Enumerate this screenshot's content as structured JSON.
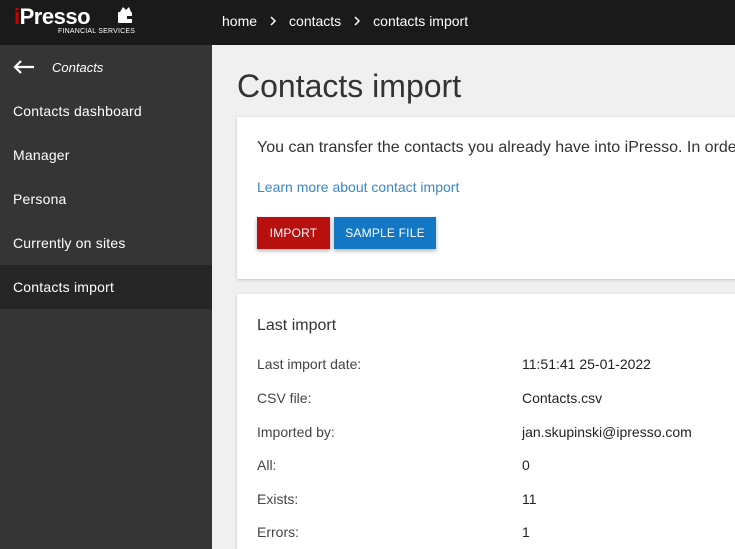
{
  "brand": {
    "name": "Presso",
    "name_initial": "i",
    "subtitle": "FINANCIAL SERVICES"
  },
  "breadcrumb": [
    {
      "label": "home"
    },
    {
      "label": "contacts"
    },
    {
      "label": "contacts import"
    }
  ],
  "sidebar": {
    "back_label": "Contacts",
    "items": [
      {
        "label": "Contacts dashboard",
        "active": false
      },
      {
        "label": "Manager",
        "active": false
      },
      {
        "label": "Persona",
        "active": false
      },
      {
        "label": "Currently on sites",
        "active": false
      },
      {
        "label": "Contacts import",
        "active": true
      }
    ]
  },
  "page": {
    "title": "Contacts import"
  },
  "intro_card": {
    "text": "You can transfer the contacts you already have into iPresso. In orde",
    "learn_more": "Learn more about contact import",
    "import_button": "IMPORT",
    "sample_button": "SAMPLE FILE"
  },
  "last_import": {
    "title": "Last import",
    "rows": [
      {
        "label": "Last import date:",
        "value": "11:51:41 25-01-2022"
      },
      {
        "label": "CSV file:",
        "value": "Contacts.csv"
      },
      {
        "label": "Imported by:",
        "value": "jan.skupinski@ipresso.com"
      },
      {
        "label": "All:",
        "value": "0"
      },
      {
        "label": "Exists:",
        "value": "11"
      },
      {
        "label": "Errors:",
        "value": "1"
      }
    ]
  },
  "colors": {
    "topbar": "#1a1a1a",
    "sidebar": "#353535",
    "sidebar_active": "#262626",
    "import_button": "#b80f0f",
    "sample_button": "#1477c4",
    "link": "#3a87c8"
  }
}
